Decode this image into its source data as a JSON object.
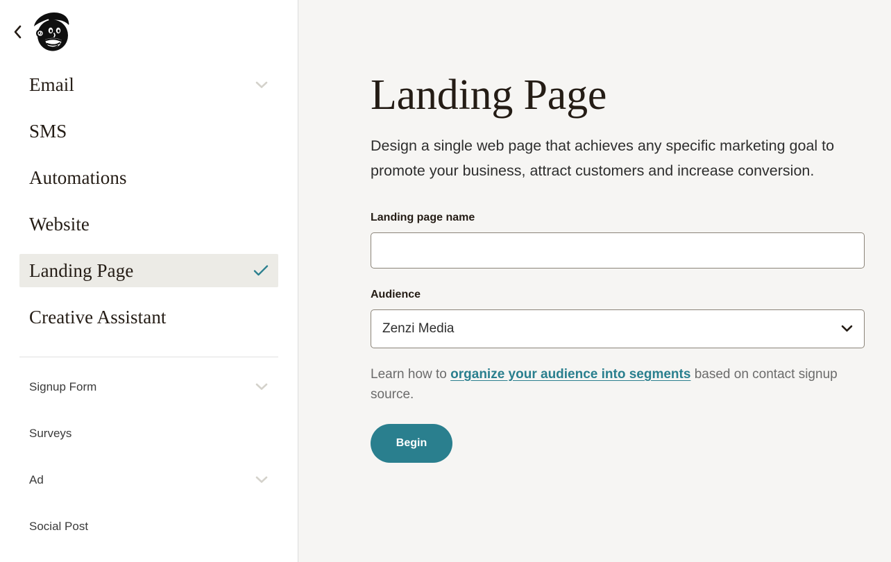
{
  "sidebar": {
    "back_button_icon": "chevron-left-icon",
    "logo_icon": "mailchimp-freddie-logo",
    "primary_items": [
      {
        "label": "Email",
        "icon": "chevron-down-icon",
        "has_chevron": true,
        "active": false
      },
      {
        "label": "SMS",
        "icon": "",
        "has_chevron": false,
        "active": false
      },
      {
        "label": "Automations",
        "icon": "",
        "has_chevron": false,
        "active": false
      },
      {
        "label": "Website",
        "icon": "",
        "has_chevron": false,
        "active": false
      },
      {
        "label": "Landing Page",
        "icon": "check-icon",
        "has_chevron": false,
        "active": true
      },
      {
        "label": "Creative Assistant",
        "icon": "",
        "has_chevron": false,
        "active": false
      }
    ],
    "secondary_items": [
      {
        "label": "Signup Form",
        "icon": "chevron-down-icon",
        "has_chevron": true
      },
      {
        "label": "Surveys",
        "icon": "",
        "has_chevron": false
      },
      {
        "label": "Ad",
        "icon": "chevron-down-icon",
        "has_chevron": true
      },
      {
        "label": "Social Post",
        "icon": "",
        "has_chevron": false
      }
    ]
  },
  "main": {
    "title": "Landing Page",
    "description": "Design a single web page that achieves any specific marketing goal to promote your business, attract customers and increase conversion.",
    "name_field": {
      "label": "Landing page name",
      "value": "",
      "placeholder": ""
    },
    "audience_field": {
      "label": "Audience",
      "selected": "Zenzi Media",
      "chevron_icon": "chevron-down-icon"
    },
    "helper": {
      "prefix": "Learn how to ",
      "link": "organize your audience into segments",
      "suffix": " based on contact signup source."
    },
    "primary_button": "Begin"
  },
  "colors": {
    "accent_teal": "#2a7f8e",
    "sidebar_bg": "#ffffff",
    "main_bg": "#f6f5f3",
    "active_item_bg": "#ecebe6",
    "text_dark": "#241c15",
    "text_muted": "#6b6b6b",
    "border": "#8a8378"
  }
}
